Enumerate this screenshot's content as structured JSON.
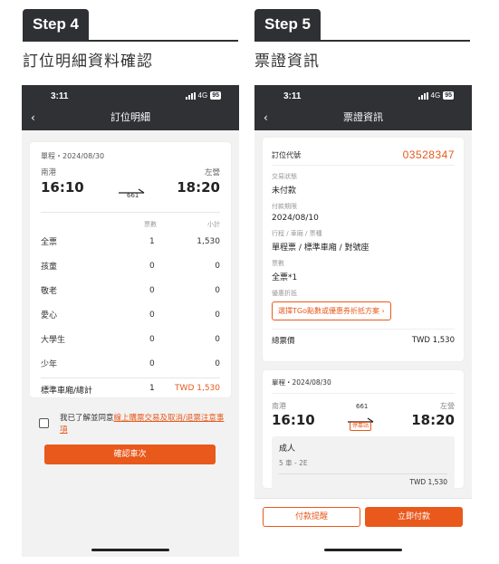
{
  "step4": {
    "badge": "Step 4",
    "title": "訂位明細資料確認",
    "status": {
      "time": "3:11",
      "network": "4G",
      "battery": "95"
    },
    "nav_title": "訂位明細",
    "back": "‹",
    "trip": {
      "header": "單程・2024/08/30",
      "from_station": "南港",
      "to_station": "左營",
      "depart": "16:10",
      "arrive": "18:20",
      "train_no": "661"
    },
    "fare_headers": {
      "qty": "票數",
      "subtotal": "小計"
    },
    "fares": [
      {
        "name": "全票",
        "qty": "1",
        "subtotal": "1,530"
      },
      {
        "name": "孩童",
        "qty": "0",
        "subtotal": "0"
      },
      {
        "name": "敬老",
        "qty": "0",
        "subtotal": "0"
      },
      {
        "name": "愛心",
        "qty": "0",
        "subtotal": "0"
      },
      {
        "name": "大學生",
        "qty": "0",
        "subtotal": "0"
      },
      {
        "name": "少年",
        "qty": "0",
        "subtotal": "0"
      }
    ],
    "total": {
      "name": "標準車廂/總計",
      "qty": "1",
      "amount": "TWD 1,530"
    },
    "agree_text": "我已了解並同意",
    "agree_link": "線上購票交易及取消/退票注意事項",
    "confirm_button": "確認車次"
  },
  "step5": {
    "badge": "Step 5",
    "title": "票證資訊",
    "status": {
      "time": "3:11",
      "network": "4G",
      "battery": "95"
    },
    "nav_title": "票證資訊",
    "back": "‹",
    "booking_code_label": "訂位代號",
    "booking_code": "03528347",
    "fields": {
      "status_label": "交易狀態",
      "status_value": "未付款",
      "deadline_label": "付款期限",
      "deadline_value": "2024/08/10",
      "type_label": "行程 / 車廂 / 票種",
      "type_value": "單程票 / 標準車廂 / 對號座",
      "count_label": "票數",
      "count_value": "全票*1",
      "discount_label": "優惠折抵",
      "discount_button": "選擇TGo點數或優惠券折抵方案 ›"
    },
    "total_label": "總票價",
    "total_value": "TWD 1,530",
    "train": {
      "header": "單程・2024/08/30",
      "from_station": "南港",
      "to_station": "左營",
      "depart": "16:10",
      "arrive": "18:20",
      "train_no": "661",
      "stop_badge": "停靠站"
    },
    "passenger": {
      "type": "成人",
      "seat": "5 車 - 2E",
      "price": "TWD 1,530"
    },
    "remind_button": "付款提醒",
    "pay_button": "立即付款"
  },
  "colors": {
    "accent": "#e8591b",
    "header": "#2f3134"
  },
  "icons": [
    "back-chevron-icon",
    "signal-icon",
    "battery-icon",
    "checkbox-icon",
    "train-arrow-icon"
  ]
}
